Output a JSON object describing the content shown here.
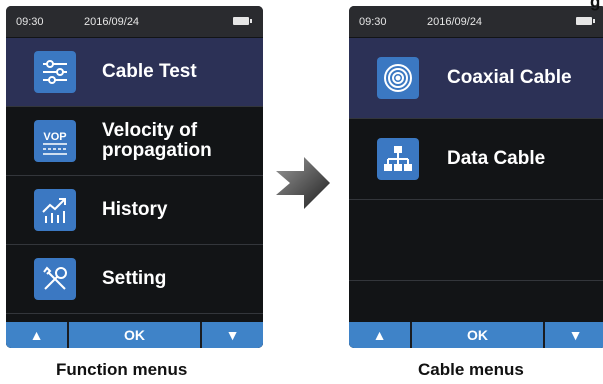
{
  "status": {
    "time": "09:30",
    "date": "2016/09/24"
  },
  "function_menu": {
    "items": [
      {
        "label": "Cable Test",
        "icon": "sliders-icon",
        "selected": true
      },
      {
        "label": "Velocity of\npropagation",
        "icon": "vop-icon",
        "icon_text": "VOP",
        "selected": false
      },
      {
        "label": "History",
        "icon": "chart-trend-icon",
        "selected": false
      },
      {
        "label": "Setting",
        "icon": "wrench-screwdriver-icon",
        "selected": false
      }
    ],
    "softkeys": {
      "up": "▲",
      "ok": "OK",
      "down": "▼"
    }
  },
  "cable_menu": {
    "items": [
      {
        "label": "Coaxial Cable",
        "icon": "coax-target-icon",
        "selected": true
      },
      {
        "label": "Data Cable",
        "icon": "network-tree-icon",
        "selected": false
      }
    ],
    "softkeys": {
      "up": "▲",
      "ok": "OK",
      "down": "▼"
    }
  },
  "captions": {
    "left": "Function menus",
    "right": "Cable menus"
  },
  "top_fragment": "g",
  "colors": {
    "screen_bg": "#121416",
    "status_bg": "#2a2b2f",
    "selected_bg": "#2c3156",
    "icon_bg": "#3b78c2",
    "softkey_bg": "#3f83c8"
  }
}
